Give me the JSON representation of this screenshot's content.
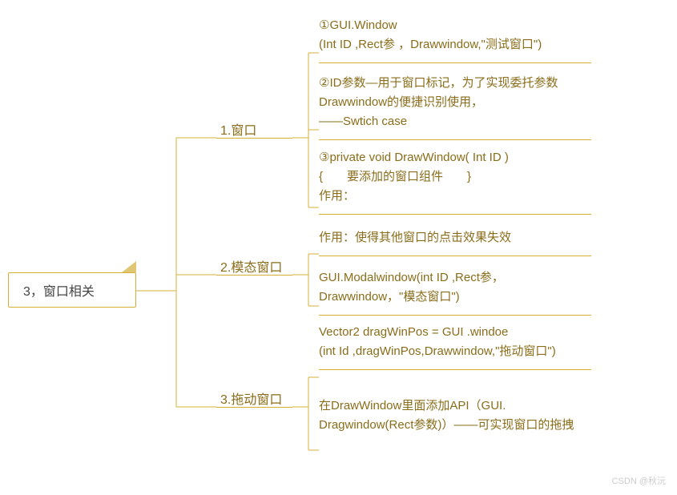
{
  "root": {
    "title": "3，窗口相关"
  },
  "branches": {
    "b1": {
      "label": "1.窗口"
    },
    "b2": {
      "label": "2.模态窗口"
    },
    "b3": {
      "label": "3.拖动窗口"
    }
  },
  "leaves": {
    "l1": "①GUI.Window\n(Int ID ,Rect参 ，Drawwindow,\"测试窗口\")",
    "l2": "②ID参数—用于窗口标记，为了实现委托参数Drawwindow的便捷识别使用，\n——Swtich case",
    "l3": "③private void DrawWindow( Int ID )\n{　　要添加的窗口组件　　}\n作用：",
    "l4": "作用：使得其他窗口的点击效果失效",
    "l5": "GUI.Modalwindow(int ID ,Rect参，Drawwindow，\"模态窗口\")",
    "l6": "Vector2 dragWinPos = GUI .windoe\n(int Id ,dragWinPos,Drawwindow,\"拖动窗口\")",
    "l7": "在DrawWindow里面添加API（GUI. Dragwindow(Rect参数)）——可实现窗口的拖拽"
  },
  "watermark": "CSDN @秋沅"
}
